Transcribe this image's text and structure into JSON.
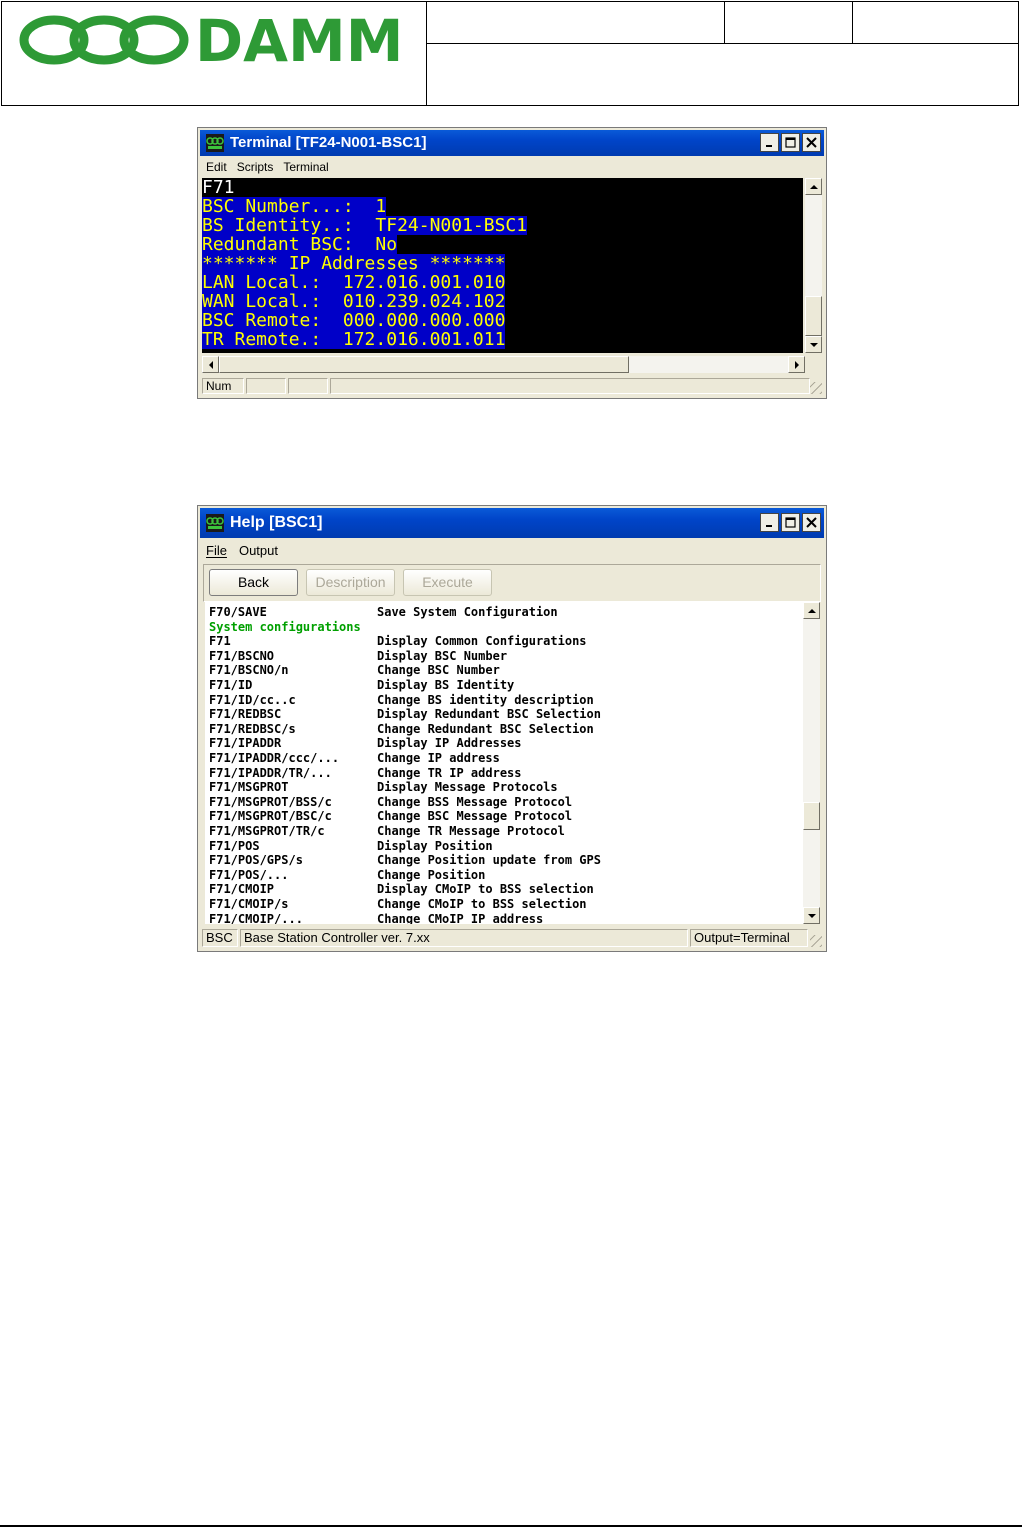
{
  "header": {
    "brand": "DAMM",
    "brand_color": "#2e9a36"
  },
  "terminal": {
    "title": "Terminal [TF24-N001-BSC1]",
    "menu": [
      "Edit",
      "Scripts",
      "Terminal"
    ],
    "lines": [
      {
        "text": "F71",
        "highlight": false
      },
      {
        "text": "BSC Number...:  1",
        "highlight": true
      },
      {
        "text": "BS Identity..:  TF24-N001-BSC1",
        "highlight": true
      },
      {
        "text": "Redundant BSC:  No",
        "highlight": true
      },
      {
        "text": "******* IP Addresses *******",
        "highlight": true
      },
      {
        "text": "LAN Local.:  172.016.001.010",
        "highlight": true
      },
      {
        "text": "WAN Local.:  010.239.024.102",
        "highlight": true
      },
      {
        "text": "BSC Remote:  000.000.000.000",
        "highlight": true
      },
      {
        "text": "TR Remote.:  172.016.001.011",
        "highlight": true
      }
    ],
    "status": [
      "Num",
      "",
      ""
    ]
  },
  "help": {
    "title": "Help [BSC1]",
    "menu": [
      "File",
      "Output"
    ],
    "buttons": {
      "back": "Back",
      "description": "Description",
      "execute": "Execute"
    },
    "rows": [
      {
        "cmd": "F70/SAVE",
        "desc": "Save System Configuration"
      },
      {
        "cmd": "System configurations",
        "desc": "",
        "section": true
      },
      {
        "cmd": "F71",
        "desc": "Display Common Configurations"
      },
      {
        "cmd": "F71/BSCNO",
        "desc": "Display BSC Number"
      },
      {
        "cmd": "F71/BSCNO/n",
        "desc": "Change BSC Number"
      },
      {
        "cmd": "F71/ID",
        "desc": "Display BS Identity"
      },
      {
        "cmd": "F71/ID/cc..c",
        "desc": "Change BS identity description"
      },
      {
        "cmd": "F71/REDBSC",
        "desc": "Display Redundant BSC Selection"
      },
      {
        "cmd": "F71/REDBSC/s",
        "desc": "Change Redundant BSC Selection"
      },
      {
        "cmd": "F71/IPADDR",
        "desc": "Display IP Addresses"
      },
      {
        "cmd": "F71/IPADDR/ccc/...",
        "desc": "Change IP address"
      },
      {
        "cmd": "F71/IPADDR/TR/...",
        "desc": "Change TR IP address"
      },
      {
        "cmd": "F71/MSGPROT",
        "desc": "Display Message Protocols"
      },
      {
        "cmd": "F71/MSGPROT/BSS/c",
        "desc": "Change BSS Message Protocol"
      },
      {
        "cmd": "F71/MSGPROT/BSC/c",
        "desc": "Change BSC Message Protocol"
      },
      {
        "cmd": "F71/MSGPROT/TR/c",
        "desc": "Change TR Message Protocol"
      },
      {
        "cmd": "F71/POS",
        "desc": "Display Position"
      },
      {
        "cmd": "F71/POS/GPS/s",
        "desc": "Change Position update from GPS"
      },
      {
        "cmd": "F71/POS/...",
        "desc": "Change Position"
      },
      {
        "cmd": "F71/CMOIP",
        "desc": "Display CMoIP to BSS selection"
      },
      {
        "cmd": "F71/CMOIP/s",
        "desc": "Change CMoIP to BSS selection"
      },
      {
        "cmd": "F71/CMOIP/...",
        "desc": "Change CMoIP IP address"
      }
    ],
    "status": {
      "left": "BSC",
      "middle": "Base Station Controller ver. 7.xx",
      "right": "Output=Terminal"
    }
  }
}
